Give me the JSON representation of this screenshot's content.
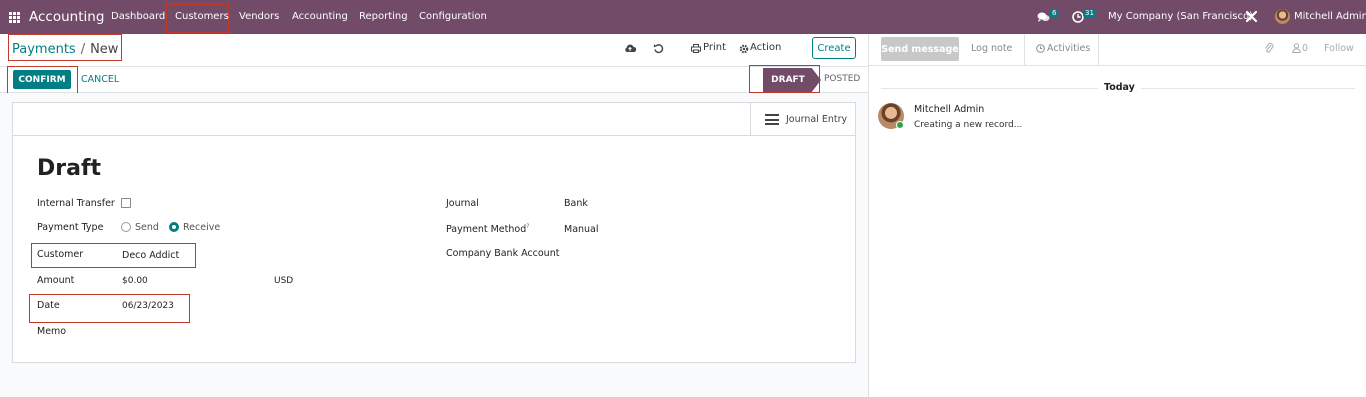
{
  "navbar": {
    "app_name": "Accounting",
    "menu": [
      "Dashboard",
      "Customers",
      "Vendors",
      "Accounting",
      "Reporting",
      "Configuration"
    ],
    "messages_count": "6",
    "activities_count": "31",
    "company": "My Company (San Francisco)",
    "user": "Mitchell Admin"
  },
  "breadcrumb": {
    "parent": "Payments",
    "separator": "/",
    "current": "New"
  },
  "control_panel": {
    "print_label": "Print",
    "action_label": "Action",
    "create_label": "Create"
  },
  "statusbar": {
    "confirm_label": "CONFIRM",
    "cancel_label": "CANCEL",
    "states": [
      "DRAFT",
      "POSTED"
    ],
    "active_state": "DRAFT"
  },
  "form": {
    "journal_entry_button": "Journal Entry",
    "title": "Draft",
    "fields": {
      "internal_transfer_label": "Internal Transfer",
      "internal_transfer_checked": false,
      "payment_type_label": "Payment Type",
      "payment_type_options": [
        "Send",
        "Receive"
      ],
      "payment_type_selected": "Receive",
      "customer_label": "Customer",
      "customer_value": "Deco Addict",
      "amount_label": "Amount",
      "amount_value": "$0.00",
      "currency_value": "USD",
      "date_label": "Date",
      "date_value": "06/23/2023",
      "memo_label": "Memo",
      "journal_label": "Journal",
      "journal_value": "Bank",
      "payment_method_label": "Payment Method",
      "payment_method_help": "?",
      "payment_method_value": "Manual",
      "company_bank_label": "Company Bank Account"
    }
  },
  "chatter": {
    "send_message": "Send message",
    "log_note": "Log note",
    "activities": "Activities",
    "attachments_count": "",
    "followers_count": "0",
    "follow": "Follow",
    "date_separator": "Today",
    "message": {
      "author": "Mitchell Admin",
      "body": "Creating a new record..."
    }
  },
  "colors": {
    "brand": "#714b67",
    "primary": "#017e84",
    "highlight": "#c0392b"
  }
}
